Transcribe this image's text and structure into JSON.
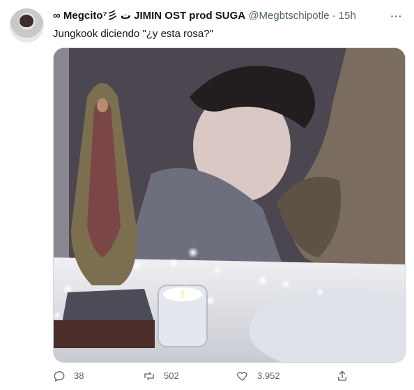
{
  "tweet": {
    "display_name": "∞ Megcito⁷彡 ت JIMIN OST prod SUGA",
    "handle": "@Megbtschipotle",
    "separator": "·",
    "time": "15h",
    "more_label": "···",
    "text": "Jungkook diciendo \"¿y esta rosa?\"",
    "media": {
      "description": "photo of a Virgin of Guadalupe statuette and a candle on a table in front of a poster of a man resting his face on a dog"
    },
    "actions": {
      "reply_count": "38",
      "retweet_count": "502",
      "like_count": "3.952"
    }
  },
  "colors": {
    "text_primary": "#0f1419",
    "text_secondary": "#536471",
    "border": "#cfd9de"
  }
}
